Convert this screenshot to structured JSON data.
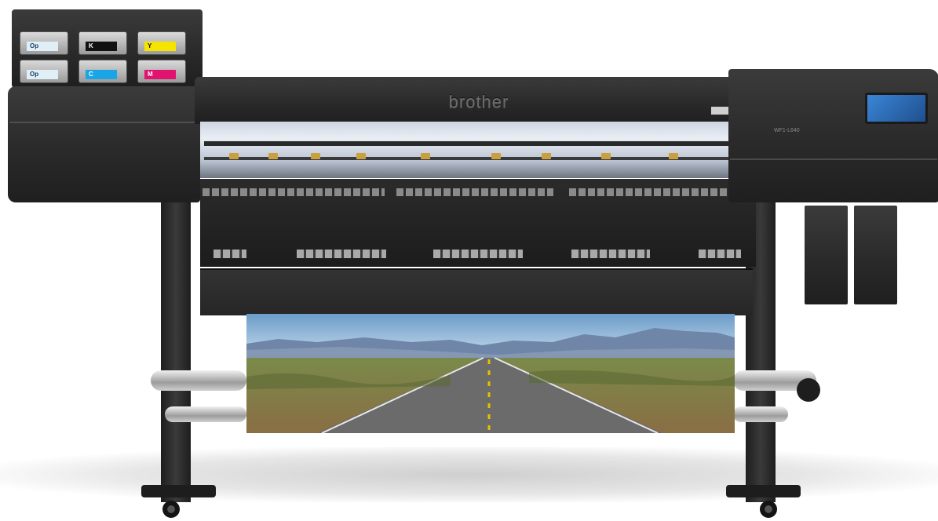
{
  "printer": {
    "brand_logo": "brother",
    "model_label": "WF1-L640",
    "ink_cartridges": [
      {
        "code": "Op",
        "color": "#dfeff5"
      },
      {
        "code": "K",
        "color": "#111111"
      },
      {
        "code": "Y",
        "color": "#f4e400"
      },
      {
        "code": "Op",
        "color": "#dfeff5"
      },
      {
        "code": "C",
        "color": "#1aa6e6"
      },
      {
        "code": "M",
        "color": "#e0136f"
      }
    ],
    "colors": {
      "body": "#2d2d2d",
      "accent": "#c9a040",
      "screen": "#2a6fbf"
    }
  }
}
